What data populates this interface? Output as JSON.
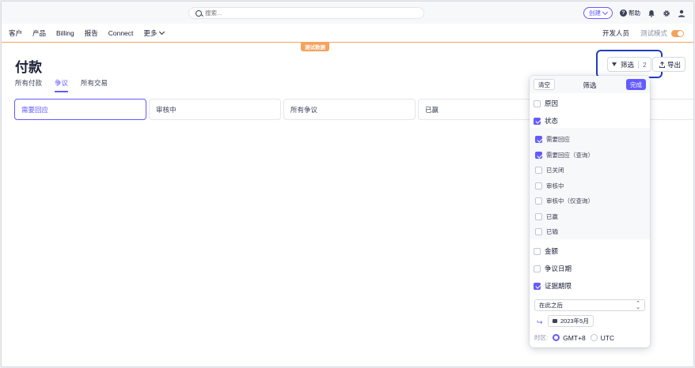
{
  "topbar": {
    "search_placeholder": "搜索...",
    "create_label": "创建",
    "help_label": "帮助",
    "icons": [
      "search-icon",
      "chevron-down-icon",
      "question-icon",
      "bell-icon",
      "gear-icon",
      "user-icon"
    ]
  },
  "nav": {
    "items": [
      "客户",
      "产品",
      "Billing",
      "报告",
      "Connect",
      "更多"
    ],
    "developers_label": "开发人员",
    "test_mode_label": "测试模式",
    "test_mode_on": true,
    "test_badge": "测试数据"
  },
  "page": {
    "title": "付款",
    "tabs": [
      "所有付款",
      "争议",
      "所有交易"
    ],
    "active_tab": "争议",
    "cards": [
      "需要回应",
      "审核中",
      "所有争议",
      "已赢",
      ""
    ],
    "active_card": "需要回应",
    "filter_label": "筛选",
    "filter_count": "2",
    "export_label": "导出"
  },
  "filter_popover": {
    "clear_label": "清空",
    "title": "筛选",
    "done_label": "完成",
    "reason_label": "原因",
    "status_label": "状态",
    "status_options": [
      {
        "label": "需要回应",
        "checked": true
      },
      {
        "label": "需要回应（查询）",
        "checked": true
      },
      {
        "label": "已关闭",
        "checked": false
      },
      {
        "label": "审核中",
        "checked": false
      },
      {
        "label": "审核中（仅查询）",
        "checked": false
      },
      {
        "label": "已赢",
        "checked": false
      },
      {
        "label": "已输",
        "checked": false
      }
    ],
    "amount_label": "金额",
    "dispute_date_label": "争议日期",
    "evidence_due_label": "证据期限",
    "evidence_due_checked": true,
    "condition_value": "在此之后",
    "date_value": "2023年5月",
    "timezone_label": "时区:",
    "tz_options": [
      "GMT+8",
      "UTC"
    ],
    "tz_selected": "GMT+8"
  },
  "colors": {
    "accent": "#635bff",
    "test_orange": "#f5a25d",
    "highlight_box": "#1f3fbf"
  }
}
